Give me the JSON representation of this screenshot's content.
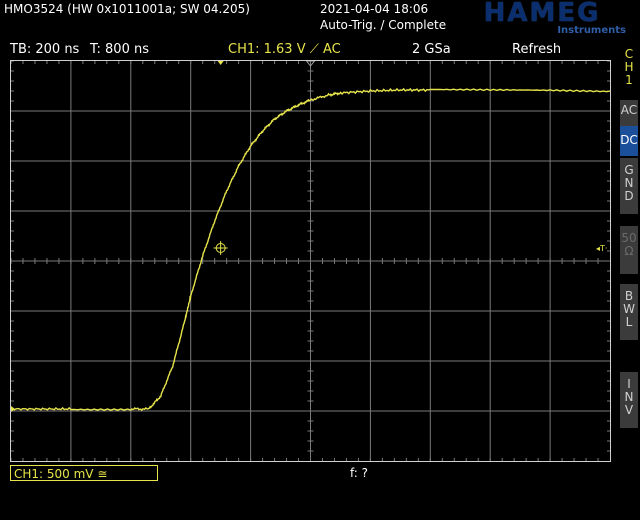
{
  "header": {
    "device": "HMO3524 (HW 0x1011001a; SW 04.205)",
    "date": "2021-04-04 18:06",
    "trigger_status": "Auto-Trig. / Complete",
    "logo": "HAMEG",
    "logo_sub": "Instruments"
  },
  "status_bar": {
    "timebase": "TB: 200 ns",
    "trigger_pos": "T: 800 ns",
    "channel_setting": "CH1: 1.63 V ⟋ AC",
    "sample_rate": "2 GSa",
    "mode": "Refresh"
  },
  "bottom": {
    "ch1_scale": "CH1: 500 mV ≅",
    "frequency": "f: ?"
  },
  "sidebar": {
    "channel": [
      "C",
      "H",
      "1"
    ],
    "ac": "AC",
    "dc": "DC",
    "gnd": [
      "G",
      "N",
      "D"
    ],
    "fifty": [
      "50",
      "Ω"
    ],
    "bwl": [
      "B",
      "W",
      "L"
    ],
    "inv": [
      "I",
      "N",
      "V"
    ]
  },
  "markers": {
    "channel_marker": "1",
    "trigger_level_marker": "◂T·"
  },
  "colors": {
    "trace": "#e6e44a",
    "grid": "#7a7a7a",
    "active_coupling": "#1b4f9a"
  },
  "chart_data": {
    "type": "line",
    "x_unit": "ns",
    "y_unit": "V",
    "xlim": [
      -800,
      1200
    ],
    "ylim": [
      -2.0,
      2.0
    ],
    "x_div": 200,
    "y_div": 0.5,
    "series": [
      {
        "x": [
          -800,
          -700,
          -600,
          -400,
          -340,
          -300,
          -260,
          -220,
          -200,
          -160,
          -120,
          -80,
          -40,
          0,
          40,
          80,
          120,
          160,
          200,
          260,
          300,
          400,
          500,
          600,
          800,
          1000,
          1200
        ],
        "y": [
          -1.48,
          -1.48,
          -1.48,
          -1.48,
          -1.48,
          -1.35,
          -1.05,
          -0.6,
          -0.35,
          0.05,
          0.4,
          0.7,
          0.95,
          1.15,
          1.3,
          1.42,
          1.5,
          1.56,
          1.61,
          1.66,
          1.68,
          1.7,
          1.71,
          1.71,
          1.71,
          1.71,
          1.7
        ]
      }
    ],
    "cursor": {
      "x": -100,
      "y": 0.13
    }
  }
}
